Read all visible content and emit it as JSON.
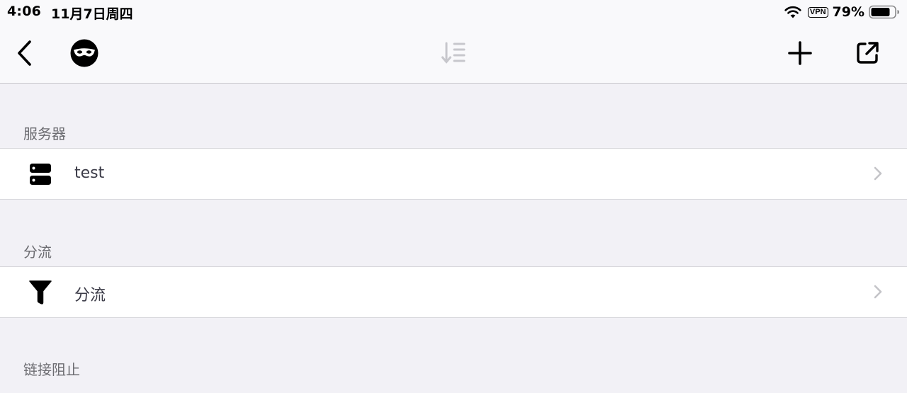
{
  "status_bar": {
    "time": "4:06",
    "date": "11月7日周四",
    "vpn": "VPN",
    "battery": "79%"
  },
  "nav": {
    "back_icon": "chevron-left-icon",
    "mask_icon": "incognito-mask-icon",
    "sort_icon": "sort-icon",
    "add_icon": "plus-icon",
    "share_icon": "external-link-icon"
  },
  "sections": [
    {
      "header": "服务器",
      "rows": [
        {
          "label": "test",
          "icon": "server-icon"
        }
      ]
    },
    {
      "header": "分流",
      "rows": [
        {
          "label": "分流",
          "icon": "filter-icon"
        }
      ]
    },
    {
      "header": "链接阻止",
      "rows": []
    }
  ],
  "colors": {
    "background": "#f2f1f6",
    "bar": "#f9f9fb",
    "section_header": "#6d6d72",
    "row_text": "#3c3c48",
    "chevron": "#c4c4c8",
    "disabled_icon": "#c7c7cc"
  }
}
